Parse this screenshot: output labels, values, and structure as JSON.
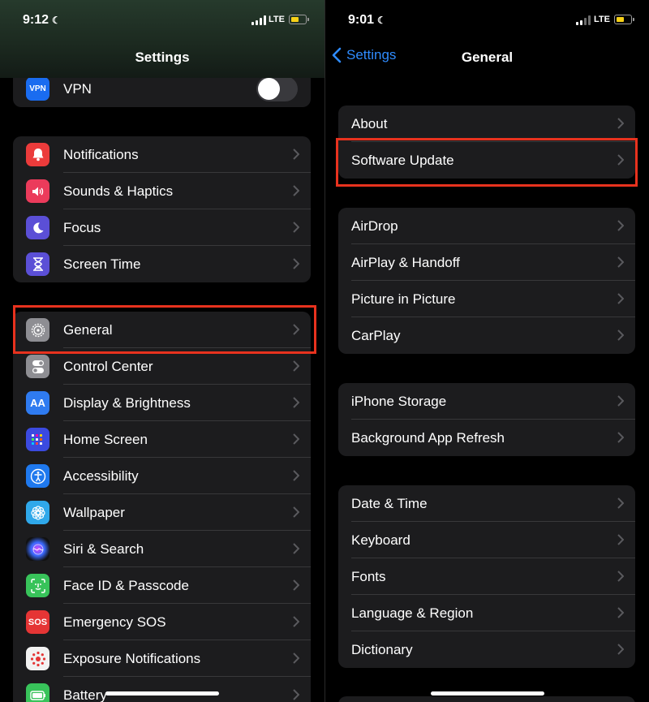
{
  "left": {
    "status": {
      "time": "9:12",
      "network": "LTE"
    },
    "nav": {
      "title": "Settings"
    },
    "top_group": [
      {
        "label": "VPN",
        "icon": "vpn-icon",
        "icon_text": "VPN",
        "color": "#1a6cf0",
        "toggle": false
      }
    ],
    "group1": [
      {
        "label": "Notifications",
        "icon": "bell-icon",
        "color": "#eb3b3b"
      },
      {
        "label": "Sounds & Haptics",
        "icon": "speaker-icon",
        "color": "#eb3b5b"
      },
      {
        "label": "Focus",
        "icon": "moon-icon",
        "color": "#5b4fd6"
      },
      {
        "label": "Screen Time",
        "icon": "hourglass-icon",
        "color": "#5b4fd6"
      }
    ],
    "group2": [
      {
        "label": "General",
        "icon": "gear-icon",
        "color": "#8e8e93"
      },
      {
        "label": "Control Center",
        "icon": "switches-icon",
        "color": "#8e8e93"
      },
      {
        "label": "Display & Brightness",
        "icon": "display-icon",
        "icon_text": "AA",
        "color": "#2f7bf0"
      },
      {
        "label": "Home Screen",
        "icon": "grid-icon",
        "color": "#3b4ae0"
      },
      {
        "label": "Accessibility",
        "icon": "accessibility-icon",
        "color": "#1f79ee"
      },
      {
        "label": "Wallpaper",
        "icon": "flower-icon",
        "color": "#2fa8ea"
      },
      {
        "label": "Siri & Search",
        "icon": "siri-icon",
        "color": "#222"
      },
      {
        "label": "Face ID & Passcode",
        "icon": "faceid-icon",
        "color": "#38c35a"
      },
      {
        "label": "Emergency SOS",
        "icon": "sos-icon",
        "icon_text": "SOS",
        "color": "#e53535"
      },
      {
        "label": "Exposure Notifications",
        "icon": "exposure-icon",
        "color": "#f2f2f2"
      },
      {
        "label": "Battery",
        "icon": "battery-icon",
        "color": "#38c35a"
      }
    ]
  },
  "right": {
    "status": {
      "time": "9:01",
      "network": "LTE"
    },
    "nav": {
      "title": "General",
      "back_label": "Settings"
    },
    "groups": [
      [
        {
          "label": "About"
        },
        {
          "label": "Software Update"
        }
      ],
      [
        {
          "label": "AirDrop"
        },
        {
          "label": "AirPlay & Handoff"
        },
        {
          "label": "Picture in Picture"
        },
        {
          "label": "CarPlay"
        }
      ],
      [
        {
          "label": "iPhone Storage"
        },
        {
          "label": "Background App Refresh"
        }
      ],
      [
        {
          "label": "Date & Time"
        },
        {
          "label": "Keyboard"
        },
        {
          "label": "Fonts"
        },
        {
          "label": "Language & Region"
        },
        {
          "label": "Dictionary"
        }
      ]
    ]
  },
  "colors": {
    "accent": "#2f8cff",
    "highlight": "#e8321e",
    "battery": "#f7d117"
  }
}
